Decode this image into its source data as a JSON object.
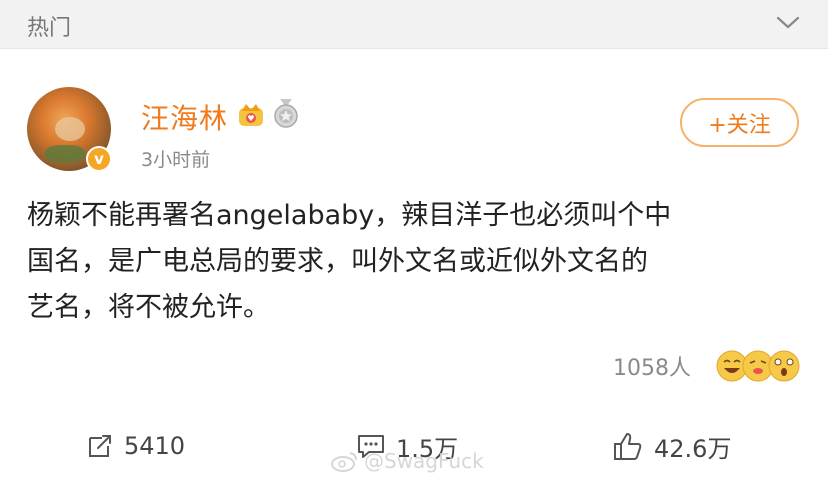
{
  "header": {
    "title": "热门"
  },
  "post": {
    "username": "汪海林",
    "time": "3小时前",
    "follow_label": "+关注",
    "content_lines": [
      "杨颖不能再署名angelababy，辣目洋子也必须叫个中",
      "国名，是广电总局的要求，叫外文名或近似外文名的",
      "艺名，将不被允许。"
    ],
    "reactions_count": "1058人",
    "verified_badge": "v"
  },
  "actions": {
    "repost": "5410",
    "comment": "1.5万",
    "like": "42.6万"
  },
  "watermark": {
    "text": "@SwagFuck"
  },
  "colors": {
    "accent": "#f07b1d",
    "follow_border": "#f7b36b",
    "header_bg": "#f2f2f2",
    "badge": "#f5a623"
  }
}
